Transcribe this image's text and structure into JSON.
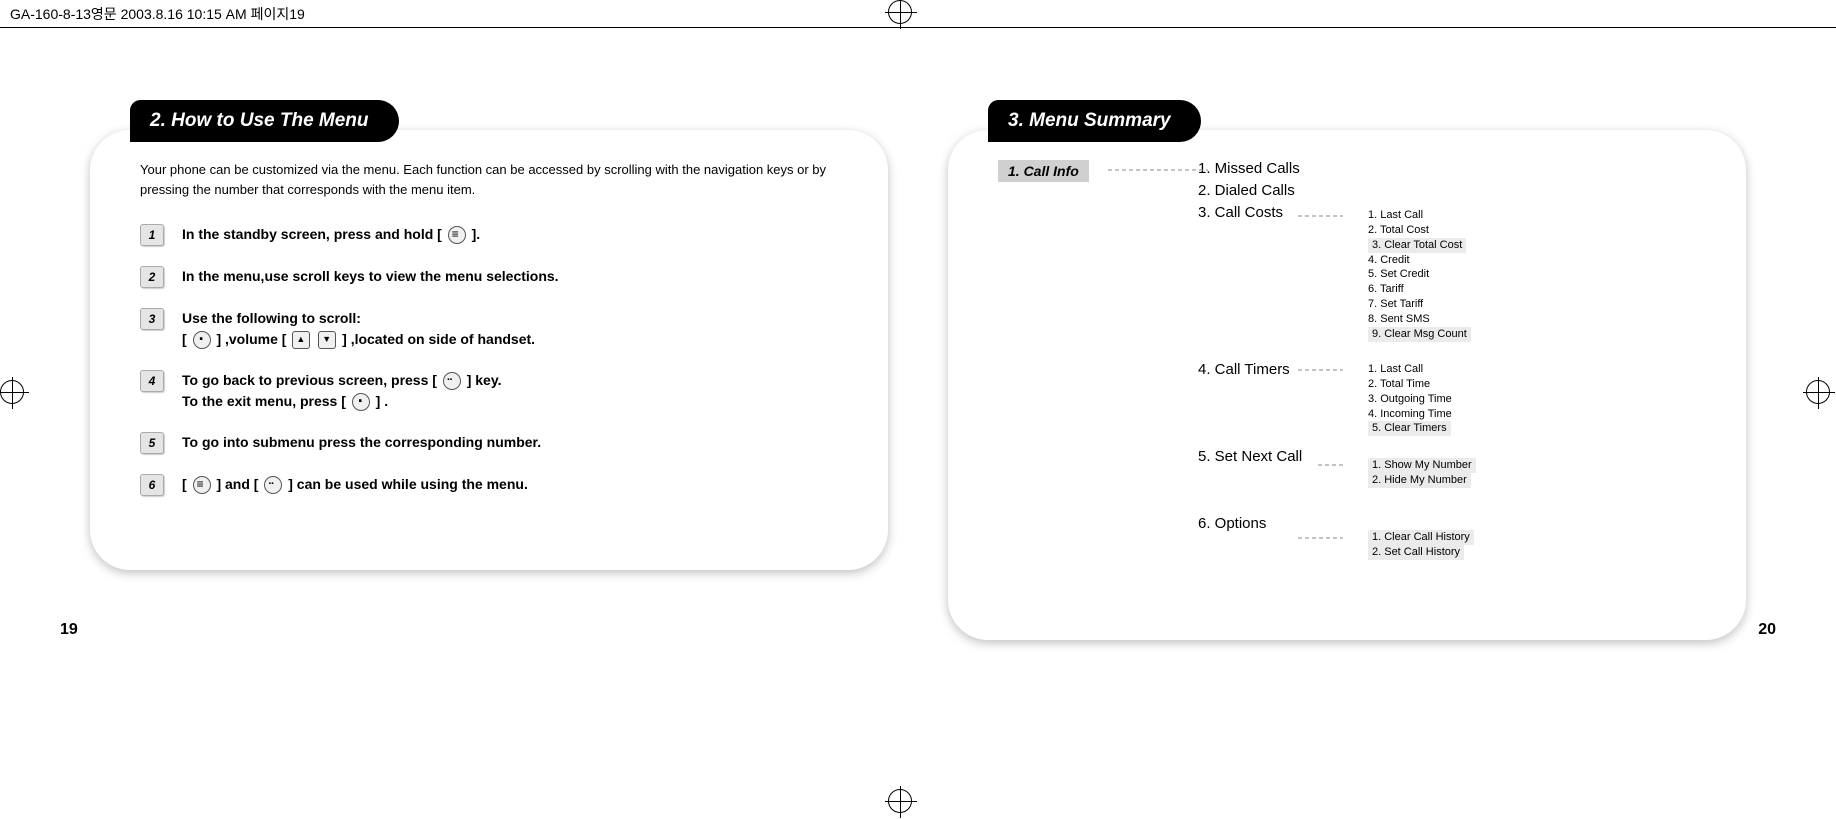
{
  "header": {
    "file_info": "GA-160-8-13영문   2003.8.16 10:15 AM   페이지19"
  },
  "left": {
    "title": "2. How to Use The Menu",
    "intro": "Your phone can be customized via the menu. Each function can be accessed by scrolling with the navigation keys or by pressing the number that corresponds with the menu item.",
    "steps": {
      "s1_pre": "In the standby screen, press and hold [",
      "s1_post": "].",
      "s2": "In the menu,use scroll keys to view the menu selections.",
      "s3_pre": "Use the following to scroll:",
      "s3_a": " [",
      "s3_b": "] ,volume [",
      "s3_c": "] ,located on side of handset.",
      "s4_pre": "To go back to previous screen, press [",
      "s4_mid": "] key.",
      "s4_exit_pre": "To the exit menu, press [",
      "s4_exit_post": "] .",
      "s5": "To go into submenu press the corresponding number.",
      "s6_a": "[",
      "s6_b": "] and [",
      "s6_c": "] can be used while using the menu."
    },
    "page_num": "19"
  },
  "right": {
    "title": "3. Menu Summary",
    "root": "1. Call Info",
    "level2": {
      "i1": "1. Missed Calls",
      "i2": "2. Dialed Calls",
      "i3": "3. Call Costs",
      "i4": "4. Call Timers",
      "i5": "5. Set Next Call",
      "i6": "6. Options"
    },
    "call_costs": {
      "l1": "1. Last Call",
      "l2": "2. Total Cost",
      "l3": "3. Clear Total Cost",
      "l4": "4. Credit",
      "l5": "5. Set Credit",
      "l6": "6. Tariff",
      "l7": "7. Set Tariff",
      "l8": "8. Sent SMS",
      "l9": "9. Clear Msg Count"
    },
    "call_timers": {
      "l1": "1. Last Call",
      "l2": "2. Total Time",
      "l3": "3. Outgoing Time",
      "l4": "4. Incoming Time",
      "l5": "5. Clear Timers"
    },
    "set_next_call": {
      "l1": "1. Show My Number",
      "l2": "2. Hide My Number"
    },
    "options": {
      "l1": "1. Clear Call History",
      "l2": "2. Set Call History"
    },
    "page_num": "20"
  }
}
